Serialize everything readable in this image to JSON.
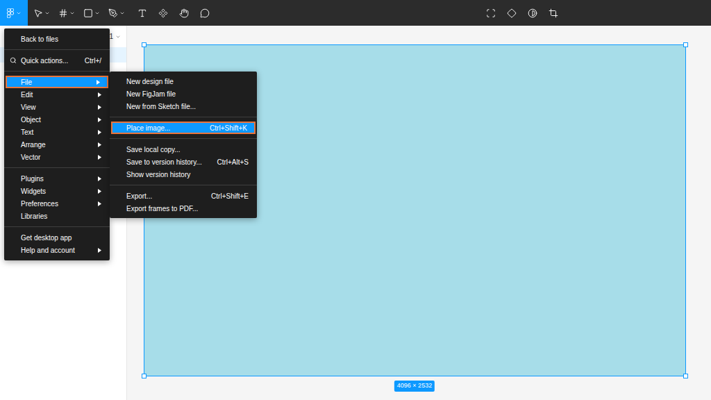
{
  "toolbar": {
    "menu_button": {
      "selected": true
    },
    "tools": [
      {
        "kind": "move",
        "has_dropdown": true
      },
      {
        "kind": "frame",
        "has_dropdown": true
      },
      {
        "kind": "shape",
        "has_dropdown": true
      },
      {
        "kind": "pen",
        "has_dropdown": true
      },
      {
        "kind": "text",
        "has_dropdown": false
      },
      {
        "kind": "resources",
        "has_dropdown": false
      },
      {
        "kind": "hand",
        "has_dropdown": false
      },
      {
        "kind": "comment",
        "has_dropdown": false
      }
    ],
    "right_tools": [
      {
        "kind": "frame-selection"
      },
      {
        "kind": "component"
      },
      {
        "kind": "mask"
      },
      {
        "kind": "crop"
      }
    ]
  },
  "layers_panel": {
    "page_label": "1",
    "rows": [
      {
        "selected": true
      }
    ]
  },
  "main_menu": {
    "groups": [
      [
        {
          "label": "Back to files",
          "has_submenu": false,
          "selected": false,
          "kind": "plain"
        }
      ],
      [
        {
          "label": "Quick actions...",
          "shortcut": "Ctrl+/",
          "has_submenu": false,
          "selected": false,
          "kind": "search"
        }
      ],
      [
        {
          "label": "File",
          "has_submenu": true,
          "selected": true,
          "kind": "plain"
        },
        {
          "label": "Edit",
          "has_submenu": true,
          "selected": false,
          "kind": "plain"
        },
        {
          "label": "View",
          "has_submenu": true,
          "selected": false,
          "kind": "plain"
        },
        {
          "label": "Object",
          "has_submenu": true,
          "selected": false,
          "kind": "plain"
        },
        {
          "label": "Text",
          "has_submenu": true,
          "selected": false,
          "kind": "plain"
        },
        {
          "label": "Arrange",
          "has_submenu": true,
          "selected": false,
          "kind": "plain"
        },
        {
          "label": "Vector",
          "has_submenu": true,
          "selected": false,
          "kind": "plain"
        }
      ],
      [
        {
          "label": "Plugins",
          "has_submenu": true,
          "selected": false,
          "kind": "plain"
        },
        {
          "label": "Widgets",
          "has_submenu": true,
          "selected": false,
          "kind": "plain"
        },
        {
          "label": "Preferences",
          "has_submenu": true,
          "selected": false,
          "kind": "plain"
        },
        {
          "label": "Libraries",
          "has_submenu": false,
          "selected": false,
          "kind": "plain"
        }
      ],
      [
        {
          "label": "Get desktop app",
          "has_submenu": false,
          "selected": false,
          "kind": "plain"
        },
        {
          "label": "Help and account",
          "has_submenu": true,
          "selected": false,
          "kind": "plain"
        }
      ]
    ]
  },
  "file_submenu": {
    "groups": [
      [
        {
          "label": "New design file",
          "has_submenu": false,
          "selected": false,
          "kind": "plain"
        },
        {
          "label": "New FigJam file",
          "has_submenu": false,
          "selected": false,
          "kind": "plain"
        },
        {
          "label": "New from Sketch file...",
          "has_submenu": false,
          "selected": false,
          "kind": "plain"
        }
      ],
      [
        {
          "label": "Place image...",
          "shortcut": "Ctrl+Shift+K",
          "has_submenu": false,
          "selected": true,
          "kind": "plain"
        }
      ],
      [
        {
          "label": "Save local copy...",
          "has_submenu": false,
          "selected": false,
          "kind": "plain"
        },
        {
          "label": "Save to version history...",
          "shortcut": "Ctrl+Alt+S",
          "has_submenu": false,
          "selected": false,
          "kind": "plain"
        },
        {
          "label": "Show version history",
          "has_submenu": false,
          "selected": false,
          "kind": "plain"
        }
      ],
      [
        {
          "label": "Export...",
          "shortcut": "Ctrl+Shift+E",
          "has_submenu": false,
          "selected": false,
          "kind": "plain"
        },
        {
          "label": "Export frames to PDF...",
          "has_submenu": false,
          "selected": false,
          "kind": "plain"
        }
      ]
    ]
  },
  "canvas": {
    "frame": {
      "selected": true,
      "size": "4096 × 2532"
    }
  }
}
